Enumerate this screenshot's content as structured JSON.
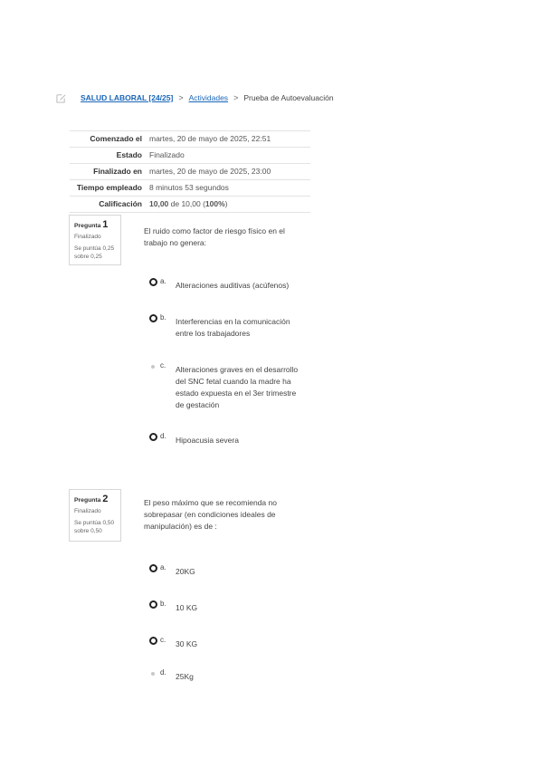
{
  "breadcrumb": {
    "course": "SALUD LABORAL [24/25]",
    "activities": "Actividades",
    "current": "Prueba de Autoevaluación",
    "separator": ">"
  },
  "summary": [
    {
      "label": "Comenzado el",
      "value": "martes, 20 de mayo de 2025, 22:51"
    },
    {
      "label": "Estado",
      "value": "Finalizado"
    },
    {
      "label": "Finalizado en",
      "value": "martes, 20 de mayo de 2025, 23:00"
    },
    {
      "label": "Tiempo empleado",
      "value": "8 minutos 53 segundos"
    },
    {
      "label": "Calificación",
      "value_bold": "10,00",
      "value_mid": " de 10,00 (",
      "value_pct": "100%",
      "value_end": ")"
    }
  ],
  "questions": [
    {
      "label": "Pregunta",
      "number": "1",
      "status": "Finalizado",
      "grade": "Se puntúa 0,25 sobre 0,25",
      "text": "El ruido como factor de riesgo físico en el trabajo no genera:",
      "options": [
        {
          "letter": "a.",
          "text": "Alteraciones auditivas (acúfenos)",
          "selected": false
        },
        {
          "letter": "b.",
          "text": "Interferencias en la comunicación entre los trabajadores",
          "selected": false
        },
        {
          "letter": "c.",
          "text": "Alteraciones graves en el desarrollo del SNC fetal cuando la madre ha estado expuesta en el 3er trimestre de gestación",
          "selected": true
        },
        {
          "letter": "d.",
          "text": "Hipoacusia severa",
          "selected": false
        }
      ]
    },
    {
      "label": "Pregunta",
      "number": "2",
      "status": "Finalizado",
      "grade": "Se puntúa 0,50 sobre 0,50",
      "text": "El peso máximo que se recomienda no sobrepasar (en condiciones ideales de manipulación) es de :",
      "options": [
        {
          "letter": "a.",
          "text": "20KG",
          "selected": false
        },
        {
          "letter": "b.",
          "text": "10 KG",
          "selected": false
        },
        {
          "letter": "c.",
          "text": "30 KG",
          "selected": false
        },
        {
          "letter": "d.",
          "text": "25Kg",
          "selected": true
        }
      ]
    }
  ]
}
